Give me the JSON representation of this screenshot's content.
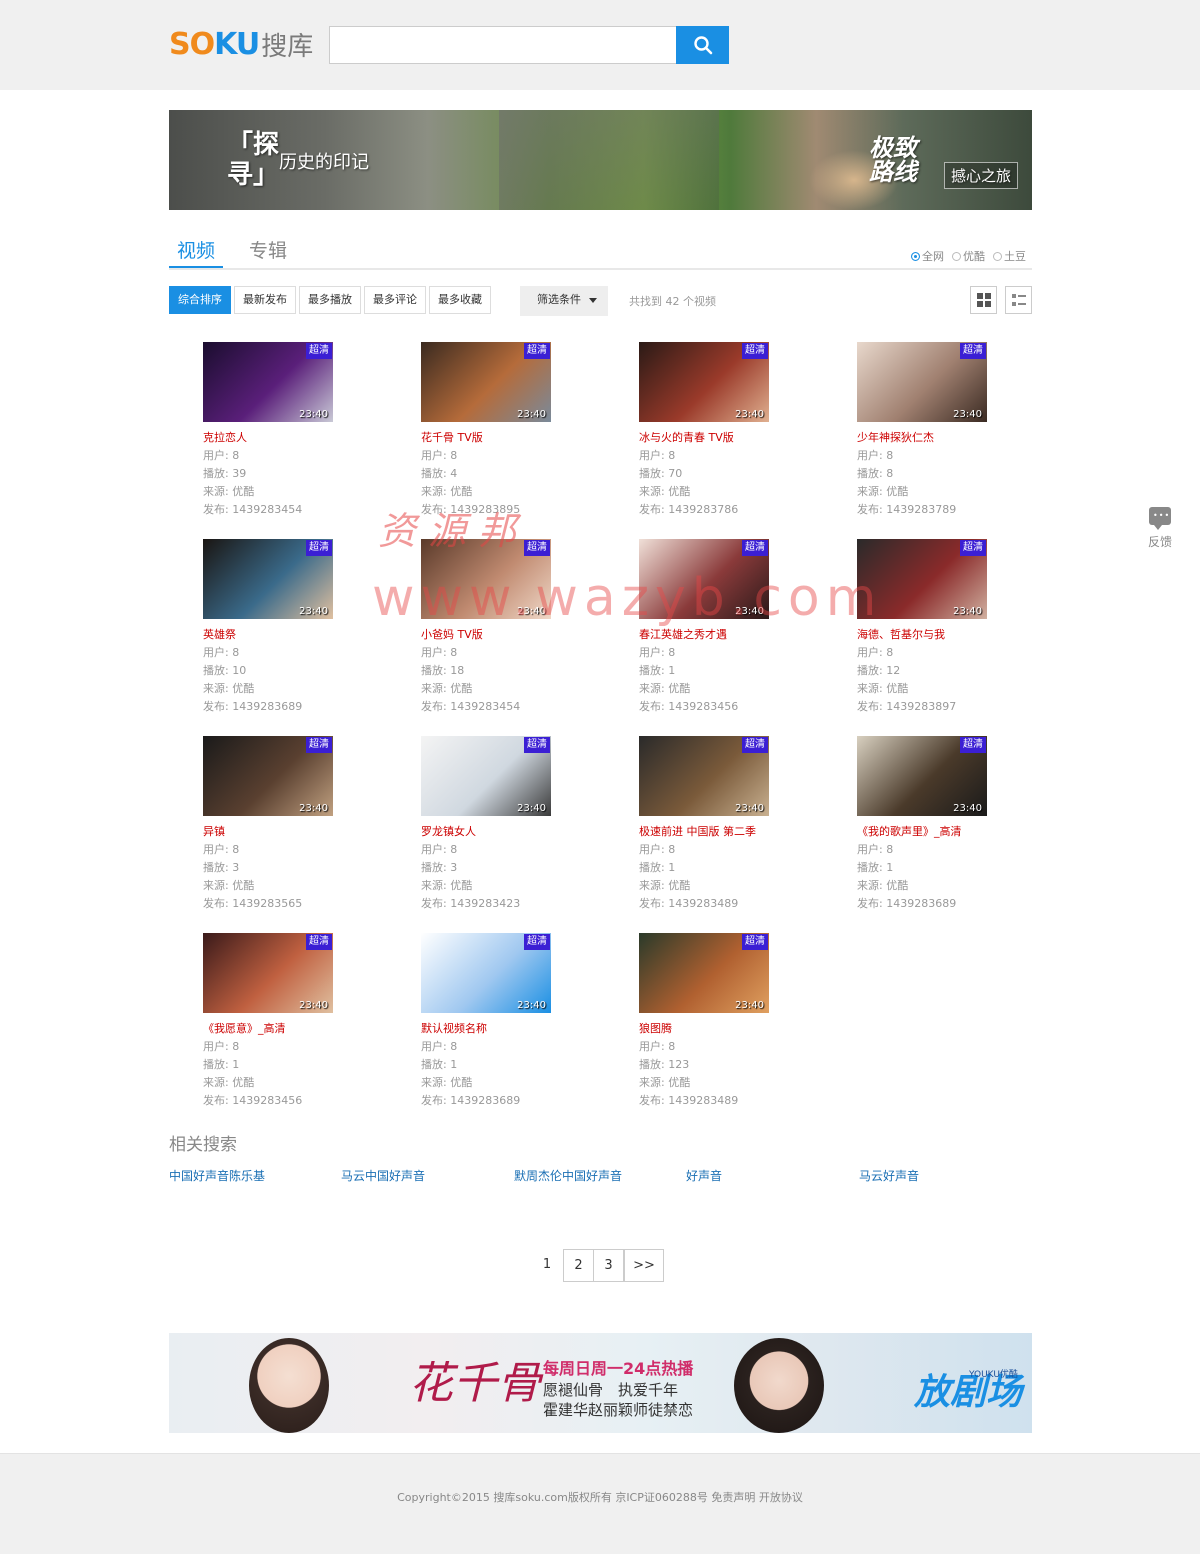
{
  "header": {
    "logo_latin": "SOKU",
    "logo_cn": "搜库",
    "search_value": "",
    "search_placeholder": ""
  },
  "banner_top": {
    "text1": "「探寻」",
    "text2": "历史的印记",
    "text3": "极致路线",
    "text4": "撼心之旅"
  },
  "tabs": [
    {
      "label": "视频",
      "active": true
    },
    {
      "label": "专辑",
      "active": false
    }
  ],
  "sources": [
    {
      "label": "全网",
      "checked": true
    },
    {
      "label": "优酷",
      "checked": false
    },
    {
      "label": "土豆",
      "checked": false
    }
  ],
  "sort_buttons": [
    {
      "label": "综合排序",
      "active": true
    },
    {
      "label": "最新发布",
      "active": false
    },
    {
      "label": "最多播放",
      "active": false
    },
    {
      "label": "最多评论",
      "active": false
    },
    {
      "label": "最多收藏",
      "active": false
    }
  ],
  "filter_label": "筛选条件",
  "found_text": "共找到 42 个视频",
  "badge_text": "超清",
  "videos": [
    {
      "title": "克拉恋人",
      "user": "用户: 8",
      "plays": "播放: 39",
      "source": "来源: 优酷",
      "published": "发布: 1439283454",
      "duration": "23:40",
      "palette": [
        "#1a0d2e",
        "#5a1f7a",
        "#c9c9d6"
      ]
    },
    {
      "title": "花千骨 TV版",
      "user": "用户: 8",
      "plays": "播放: 4",
      "source": "来源: 优酷",
      "published": "发布: 1439283895",
      "duration": "23:40",
      "palette": [
        "#3a2a20",
        "#b56b3a",
        "#7a8a9a"
      ]
    },
    {
      "title": "冰与火的青春 TV版",
      "user": "用户: 8",
      "plays": "播放: 70",
      "source": "来源: 优酷",
      "published": "发布: 1439283786",
      "duration": "23:40",
      "palette": [
        "#2a1a16",
        "#9a3a2a",
        "#e0b090"
      ]
    },
    {
      "title": "少年神探狄仁杰",
      "user": "用户: 8",
      "plays": "播放: 8",
      "source": "来源: 优酷",
      "published": "发布: 1439283789",
      "duration": "23:40",
      "palette": [
        "#e8d8cc",
        "#a08070",
        "#3a2a22"
      ]
    },
    {
      "title": "英雄祭",
      "user": "用户: 8",
      "plays": "播放: 10",
      "source": "来源: 优酷",
      "published": "发布: 1439283689",
      "duration": "23:40",
      "palette": [
        "#1a1512",
        "#3a6a8a",
        "#e0c0a0"
      ]
    },
    {
      "title": "小爸妈 TV版",
      "user": "用户: 8",
      "plays": "播放: 18",
      "source": "来源: 优酷",
      "published": "发布: 1439283454",
      "duration": "23:40",
      "palette": [
        "#5a3a2a",
        "#c08a70",
        "#f0d8c8"
      ]
    },
    {
      "title": "春江英雄之秀才遇",
      "user": "用户: 8",
      "plays": "播放: 1",
      "source": "来源: 优酷",
      "published": "发布: 1439283456",
      "duration": "23:40",
      "palette": [
        "#f0e0d8",
        "#8a3a3a",
        "#2a1a1a"
      ]
    },
    {
      "title": "海德、哲基尔与我",
      "user": "用户: 8",
      "plays": "播放: 12",
      "source": "来源: 优酷",
      "published": "发布: 1439283897",
      "duration": "23:40",
      "palette": [
        "#2a2a2a",
        "#8a2a2a",
        "#d0b0a0"
      ]
    },
    {
      "title": "异镇",
      "user": "用户: 8",
      "plays": "播放: 3",
      "source": "来源: 优酷",
      "published": "发布: 1439283565",
      "duration": "23:40",
      "palette": [
        "#1a1a1a",
        "#5a4030",
        "#c0a080"
      ]
    },
    {
      "title": "罗龙镇女人",
      "user": "用户: 8",
      "plays": "播放: 3",
      "source": "来源: 优酷",
      "published": "发布: 1439283423",
      "duration": "23:40",
      "palette": [
        "#f4f4f4",
        "#d0d8e0",
        "#3a3a3a"
      ]
    },
    {
      "title": "极速前进 中国版 第二季",
      "user": "用户: 8",
      "plays": "播放: 1",
      "source": "来源: 优酷",
      "published": "发布: 1439283489",
      "duration": "23:40",
      "palette": [
        "#2a2a2a",
        "#7a5a3a",
        "#c8b090"
      ]
    },
    {
      "title": "《我的歌声里》_高清",
      "user": "用户: 8",
      "plays": "播放: 1",
      "source": "来源: 优酷",
      "published": "发布: 1439283689",
      "duration": "23:40",
      "palette": [
        "#d8d0c0",
        "#4a3a2a",
        "#1a1a1a"
      ]
    },
    {
      "title": "《我愿意》_高清",
      "user": "用户: 8",
      "plays": "播放: 1",
      "source": "来源: 优酷",
      "published": "发布: 1439283456",
      "duration": "23:40",
      "palette": [
        "#3a1a1a",
        "#c06040",
        "#e0c0a0"
      ]
    },
    {
      "title": "默认视频名称",
      "user": "用户: 8",
      "plays": "播放: 1",
      "source": "来源: 优酷",
      "published": "发布: 1439283689",
      "duration": "23:40",
      "palette": [
        "#ffffff",
        "#a0c8f0",
        "#1a8fe3"
      ]
    },
    {
      "title": "狼图腾",
      "user": "用户: 8",
      "plays": "播放: 123",
      "source": "来源: 优酷",
      "published": "发布: 1439283489",
      "duration": "23:40",
      "palette": [
        "#2a3a2a",
        "#b06030",
        "#e0a060"
      ]
    }
  ],
  "related_title": "相关搜索",
  "related": [
    "中国好声音陈乐基",
    "马云中国好声音",
    "默周杰伦中国好声音",
    "好声音",
    "马云好声音"
  ],
  "pagination": {
    "current": "1",
    "pages": [
      "2",
      "3"
    ],
    "next": ">>"
  },
  "banner_bottom": {
    "title": "花千骨",
    "line1": "每周日周一24点热播",
    "line2": "愿褪仙骨　执爱千年",
    "line3": "霍建华赵丽颖师徒禁恋",
    "brand": "放剧场",
    "brand_small": "YOUKU优酷"
  },
  "feedback": "反馈",
  "footer": "Copyright©2015 搜库soku.com版权所有 京ICP证060288号 免责声明 开放协议",
  "watermark": {
    "line1": "资源邦",
    "line2": "www.wazyb.com"
  },
  "colors": {
    "accent": "#1a8fe3",
    "title_red": "#cc0000",
    "badge": "#3b1fd4",
    "link": "#1a6fb4"
  }
}
